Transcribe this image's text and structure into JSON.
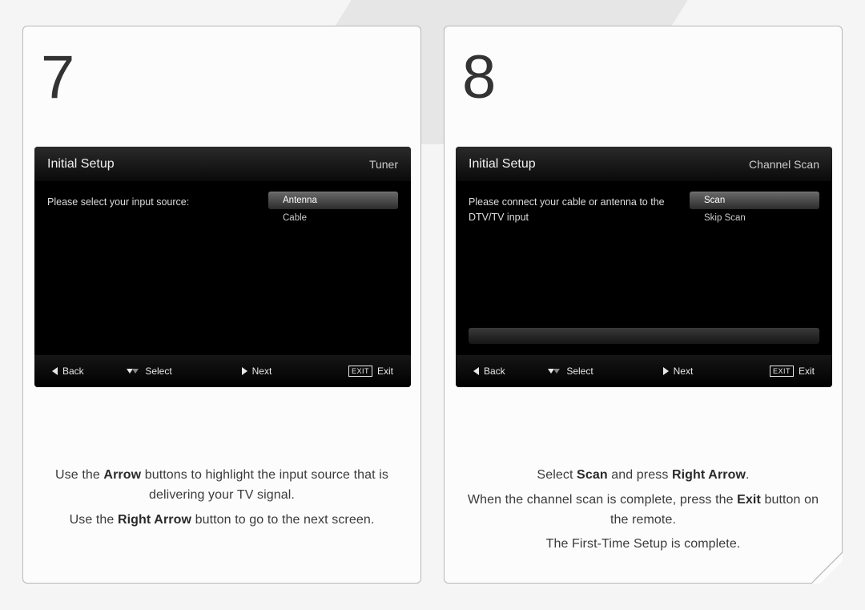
{
  "panels": [
    {
      "step": "7",
      "tv": {
        "title": "Initial Setup",
        "subtitle": "Tuner",
        "prompt": "Please select your input source:",
        "options": [
          {
            "label": "Antenna",
            "selected": true
          },
          {
            "label": "Cable",
            "selected": false
          }
        ],
        "show_progress": false,
        "footer": {
          "back": "Back",
          "select": "Select",
          "next": "Next",
          "exit_box": "EXIT",
          "exit": "Exit"
        }
      },
      "copy": {
        "l1a": "Use the ",
        "l1b": "Arrow",
        "l1c": " buttons to highlight the input source that is delivering your TV signal.",
        "l2a": "Use the ",
        "l2b": "Right Arrow",
        "l2c": " button to go to the next screen."
      }
    },
    {
      "step": "8",
      "tv": {
        "title": "Initial Setup",
        "subtitle": "Channel Scan",
        "prompt": "Please connect your cable or antenna to the DTV/TV input",
        "options": [
          {
            "label": "Scan",
            "selected": true
          },
          {
            "label": "Skip Scan",
            "selected": false
          }
        ],
        "show_progress": true,
        "footer": {
          "back": "Back",
          "select": "Select",
          "next": "Next",
          "exit_box": "EXIT",
          "exit": "Exit"
        }
      },
      "copy": {
        "l1a": "Select ",
        "l1b": "Scan",
        "l1c": " and press ",
        "l1d": "Right Arrow",
        "l1e": ".",
        "l2a": "When the channel scan is complete, press the ",
        "l2b": "Exit",
        "l2c": " button on the remote.",
        "l3": "The First-Time Setup is complete."
      }
    }
  ]
}
